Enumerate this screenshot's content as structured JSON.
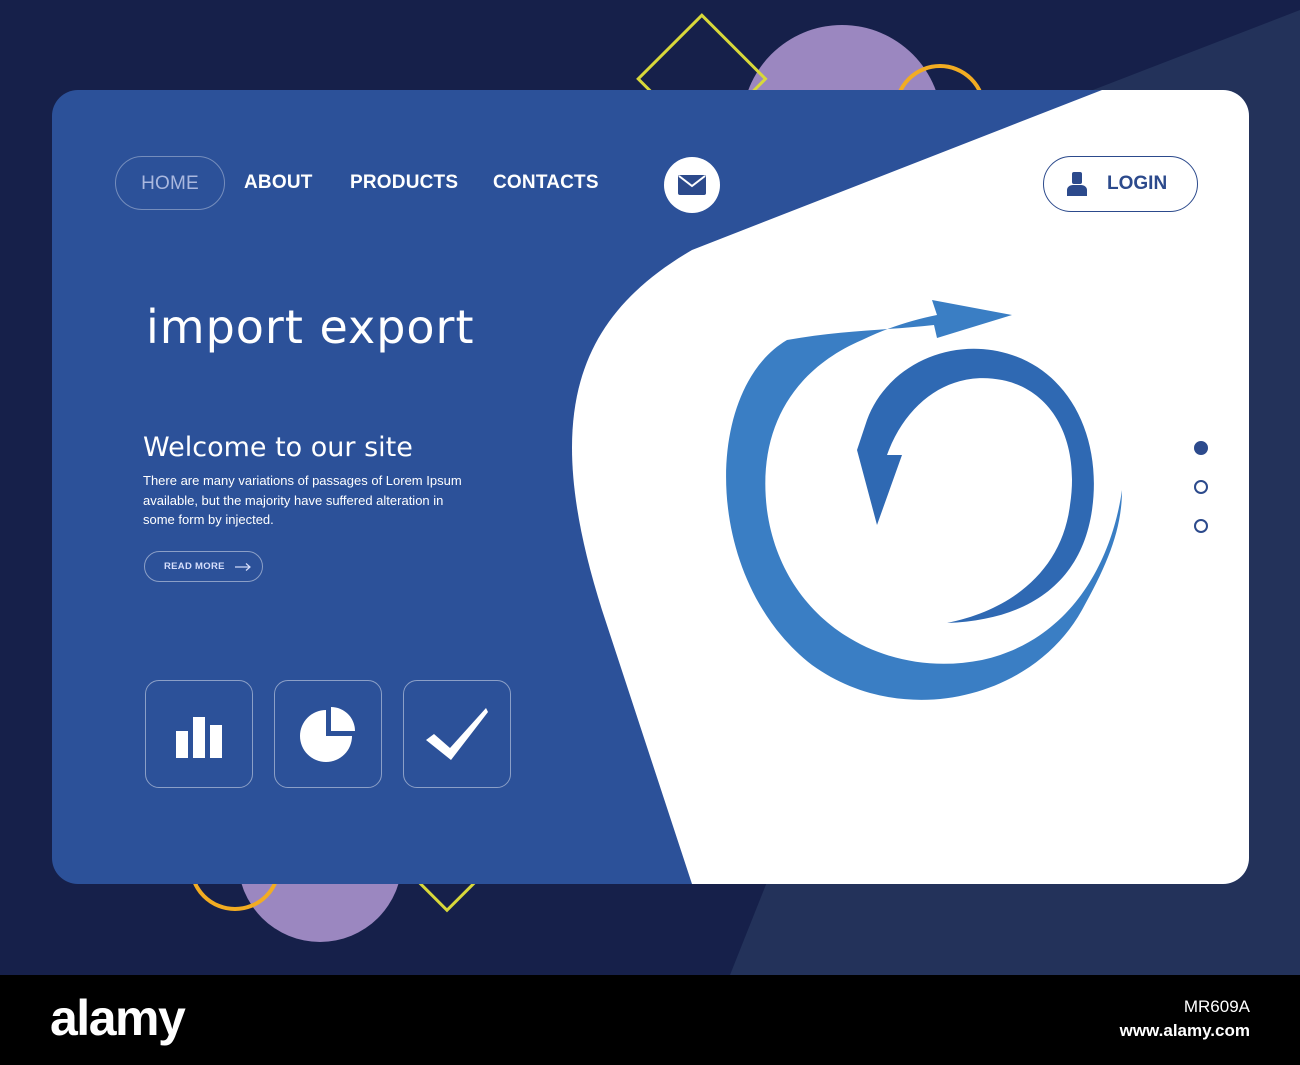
{
  "nav": {
    "home": "HOME",
    "about": "ABOUT",
    "products": "PRODUCTS",
    "contacts": "CONTACTS",
    "mail_icon": "envelope-icon",
    "login": "LOGIN",
    "login_icon": "user-icon"
  },
  "hero": {
    "title": "import export",
    "welcome": "Welcome to our site",
    "description": "There are many variations of passages of Lorem Ipsum available, but the majority have suffered alteration in some form by injected.",
    "read_more": "READ MORE",
    "read_more_icon": "arrow-right-icon",
    "graphic_icon": "circular-arrows-icon"
  },
  "features": [
    {
      "icon": "bar-chart-icon"
    },
    {
      "icon": "pie-chart-icon"
    },
    {
      "icon": "checkmark-icon"
    }
  ],
  "slider": {
    "total": 3,
    "active": 1
  },
  "footer": {
    "logo": "alamy",
    "image_id": "MR609A",
    "url": "www.alamy.com"
  },
  "colors": {
    "background": "#16204a",
    "card_blue": "#2c5199",
    "panel_white": "#ffffff",
    "accent_navy": "#2c4a8c",
    "graphic_blue": "#3a7ec4",
    "deco_purple": "#9b87c0",
    "deco_yellow": "#d8d83a",
    "deco_orange": "#f2ac22"
  }
}
